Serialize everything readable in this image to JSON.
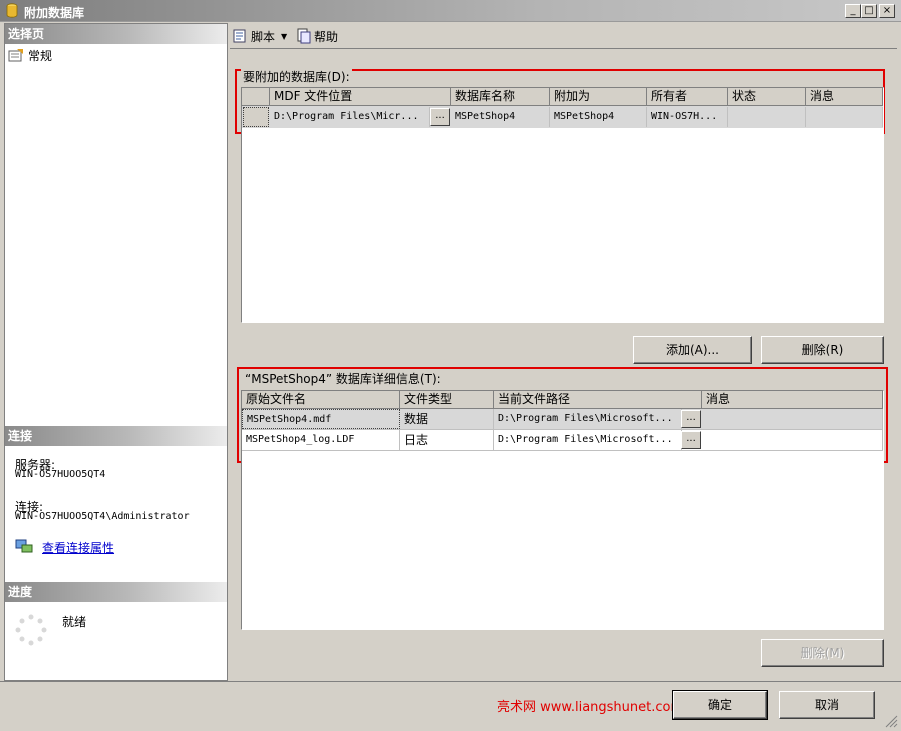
{
  "window": {
    "title": "附加数据库",
    "minimize": "_",
    "maximize": "□",
    "close": "×"
  },
  "left": {
    "select_page_header": "选择页",
    "pages": [
      {
        "label": "常规",
        "icon": "general-page-icon"
      }
    ],
    "connection_header": "连接",
    "server_label": "服务器:",
    "server_value": "WIN-OS7HUOO5QT4",
    "connection_label": "连接:",
    "connection_value": "WIN-OS7HUOO5QT4\\Administrator",
    "view_props_link": "查看连接属性",
    "progress_header": "进度",
    "progress_status": "就绪"
  },
  "toolbar": {
    "script_label": "脚本",
    "help_label": "帮助"
  },
  "databases_section": {
    "label": "要附加的数据库(D):",
    "columns": [
      "MDF 文件位置",
      "数据库名称",
      "附加为",
      "所有者",
      "状态",
      "消息"
    ],
    "rows": [
      {
        "mdf": "D:\\Program Files\\Micr...",
        "db_name": "MSPetShop4",
        "attach_as": "MSPetShop4",
        "owner": "WIN-OS7H...",
        "status": "",
        "message": ""
      }
    ],
    "ellipsis": "...",
    "add_button": "添加(A)...",
    "remove_button": "删除(R)"
  },
  "details_section": {
    "label": "“MSPetShop4” 数据库详细信息(T):",
    "columns": [
      "原始文件名",
      "文件类型",
      "当前文件路径",
      "消息"
    ],
    "rows": [
      {
        "file": "MSPetShop4.mdf",
        "type": "数据",
        "path": "D:\\Program Files\\Microsoft...",
        "message": ""
      },
      {
        "file": "MSPetShop4_log.LDF",
        "type": "日志",
        "path": "D:\\Program Files\\Microsoft...",
        "message": ""
      }
    ],
    "ellipsis": "...",
    "remove_button": "删除(M)"
  },
  "footer": {
    "watermark": "亮术网 www.liangshunet.com",
    "ok_button": "确定",
    "cancel_button": "取消"
  },
  "colors": {
    "highlight_border": "#e00000",
    "watermark": "#e00000",
    "link": "#0000cc"
  }
}
